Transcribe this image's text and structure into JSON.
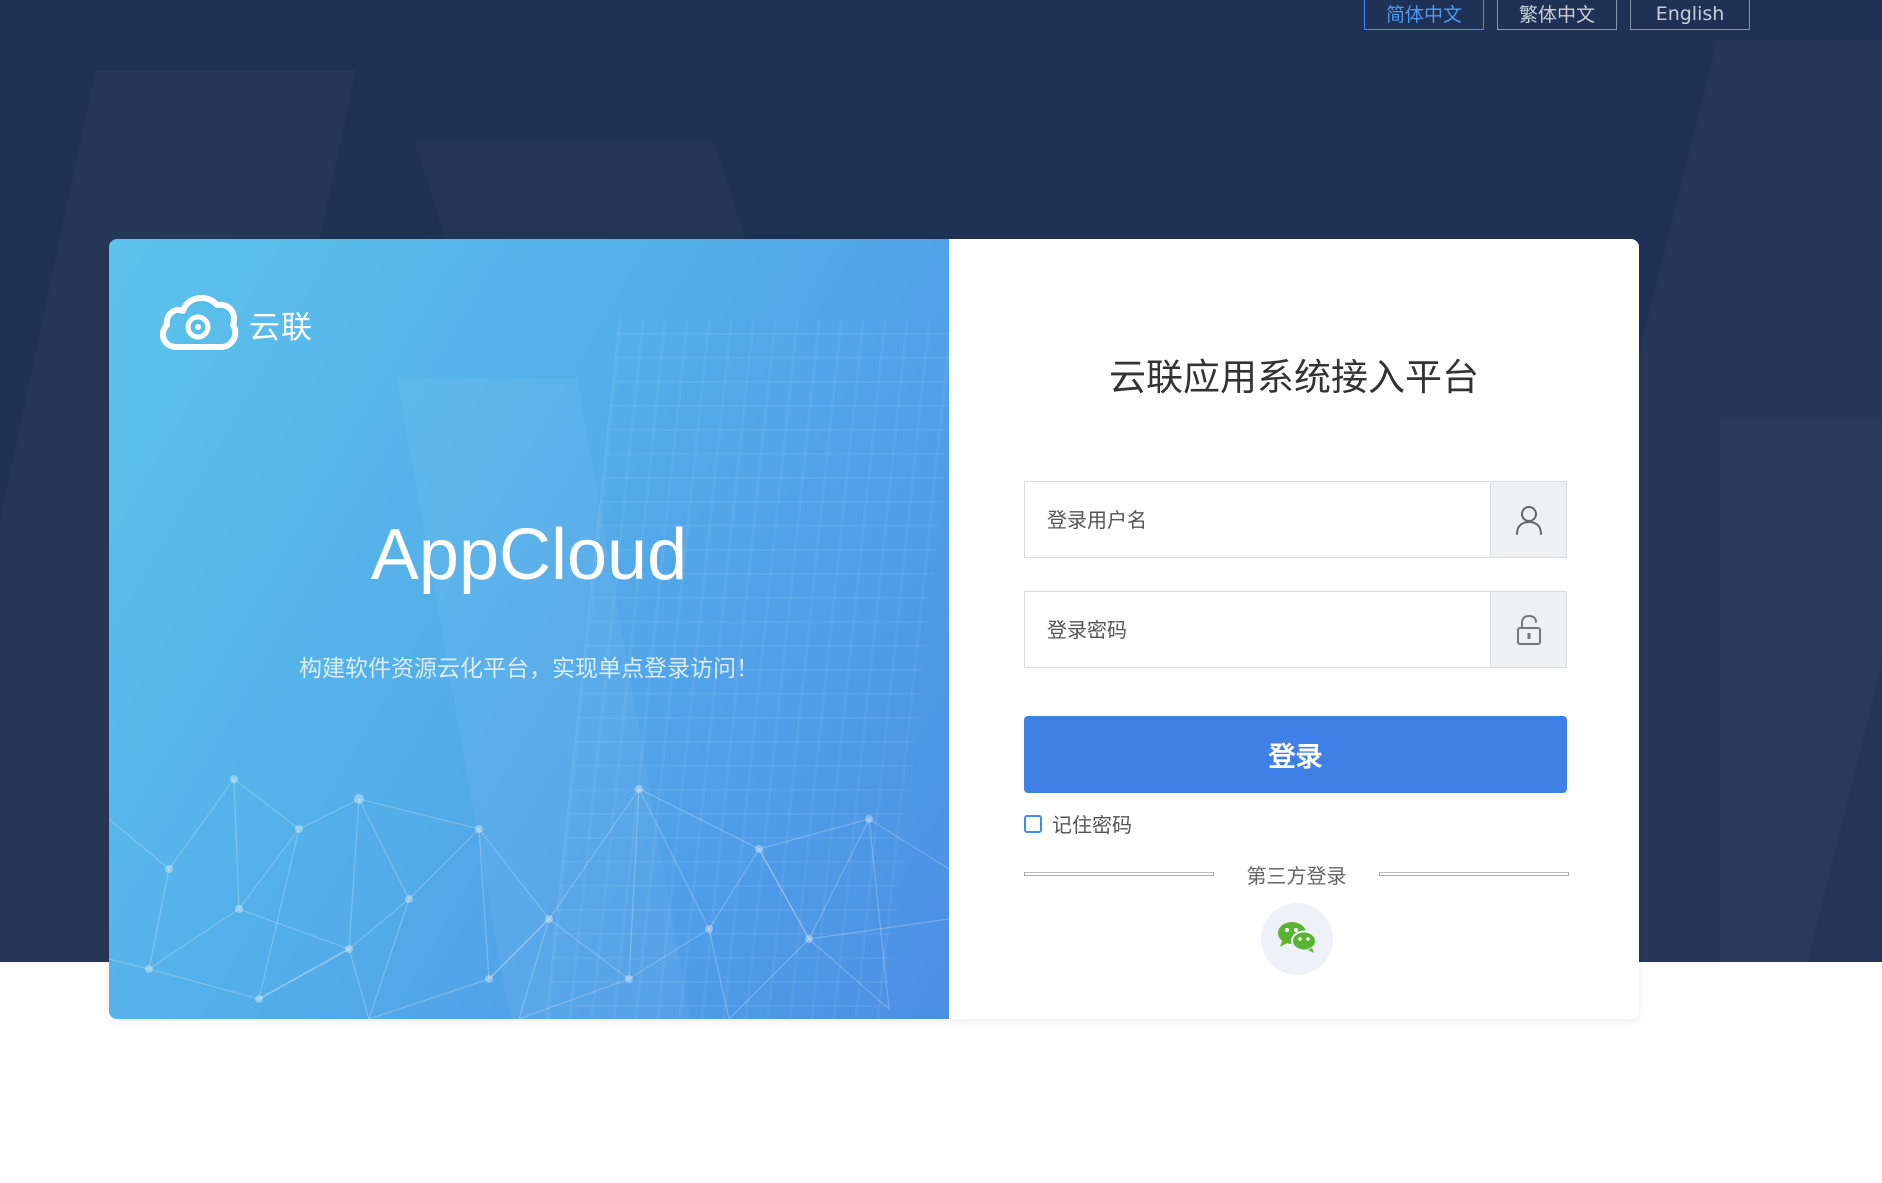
{
  "language_switch": {
    "options": [
      "简体中文",
      "繁体中文",
      "English"
    ],
    "active": "简体中文"
  },
  "brand": {
    "name": "云联"
  },
  "hero": {
    "title": "AppCloud",
    "subtitle": "构建软件资源云化平台，实现单点登录访问！"
  },
  "login": {
    "title": "云联应用系统接入平台",
    "username_placeholder": "登录用户名",
    "password_placeholder": "登录密码",
    "submit_label": "登录",
    "remember_label": "记住密码",
    "third_party_label": "第三方登录"
  },
  "icons": {
    "username": "user-icon",
    "password": "lock-icon",
    "third_party": "wechat-icon",
    "logo": "cloud-logo-icon"
  },
  "colors": {
    "accent": "#3f80e6",
    "background_dark": "#1f3154",
    "wechat_green": "#5ab433"
  }
}
